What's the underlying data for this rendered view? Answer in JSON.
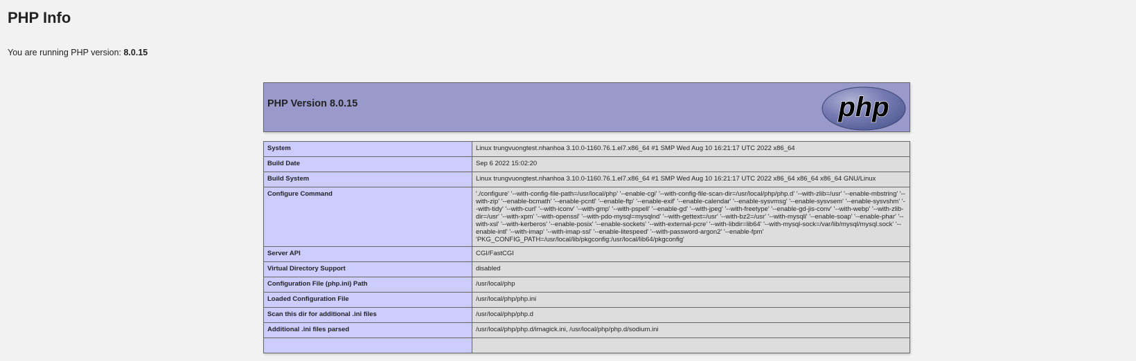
{
  "page": {
    "title": "PHP Info",
    "version_prefix": "You are running PHP version: ",
    "version": "8.0.15"
  },
  "phpinfo": {
    "header_title": "PHP Version 8.0.15",
    "logo_text": "php",
    "rows": [
      {
        "key": "System",
        "value": "Linux trungvuongtest.nhanhoa 3.10.0-1160.76.1.el7.x86_64 #1 SMP Wed Aug 10 16:21:17 UTC 2022 x86_64"
      },
      {
        "key": "Build Date",
        "value": "Sep 6 2022 15:02:20"
      },
      {
        "key": "Build System",
        "value": "Linux trungvuongtest.nhanhoa 3.10.0-1160.76.1.el7.x86_64 #1 SMP Wed Aug 10 16:21:17 UTC 2022 x86_64 x86_64 x86_64 GNU/Linux"
      },
      {
        "key": "Configure Command",
        "value": "'./configure' '--with-config-file-path=/usr/local/php' '--enable-cgi' '--with-config-file-scan-dir=/usr/local/php/php.d' '--with-zlib=/usr' '--enable-mbstring' '--with-zip' '--enable-bcmath' '--enable-pcntl' '--enable-ftp' '--enable-exif' '--enable-calendar' '--enable-sysvmsg' '--enable-sysvsem' '--enable-sysvshm' '--with-tidy' '--with-curl' '--with-iconv' '--with-gmp' '--with-pspell' '--enable-gd' '--with-jpeg' '--with-freetype' '--enable-gd-jis-conv' '--with-webp' '--with-zlib-dir=/usr' '--with-xpm' '--with-openssl' '--with-pdo-mysql=mysqlnd' '--with-gettext=/usr' '--with-bz2=/usr' '--with-mysqli' '--enable-soap' '--enable-phar' '--with-xsl' '--with-kerberos' '--enable-posix' '--enable-sockets' '--with-external-pcre' '--with-libdir=lib64' '--with-mysql-sock=/var/lib/mysql/mysql.sock' '--enable-intl' '--with-imap' '--with-imap-ssl' '--enable-litespeed' '--with-password-argon2' '--enable-fpm' 'PKG_CONFIG_PATH=/usr/local/lib/pkgconfig:/usr/local/lib64/pkgconfig'"
      },
      {
        "key": "Server API",
        "value": "CGI/FastCGI"
      },
      {
        "key": "Virtual Directory Support",
        "value": "disabled"
      },
      {
        "key": "Configuration File (php.ini) Path",
        "value": "/usr/local/php"
      },
      {
        "key": "Loaded Configuration File",
        "value": "/usr/local/php/php.ini"
      },
      {
        "key": "Scan this dir for additional .ini files",
        "value": "/usr/local/php/php.d"
      },
      {
        "key": "Additional .ini files parsed",
        "value": "/usr/local/php/php.d/imagick.ini, /usr/local/php/php.d/sodium.ini"
      },
      {
        "key": "",
        "value": ""
      }
    ]
  },
  "colors": {
    "header_bg": "#9999cc",
    "key_bg": "#ccccff",
    "value_bg": "#dddddd",
    "page_bg": "#f2f2f2"
  }
}
